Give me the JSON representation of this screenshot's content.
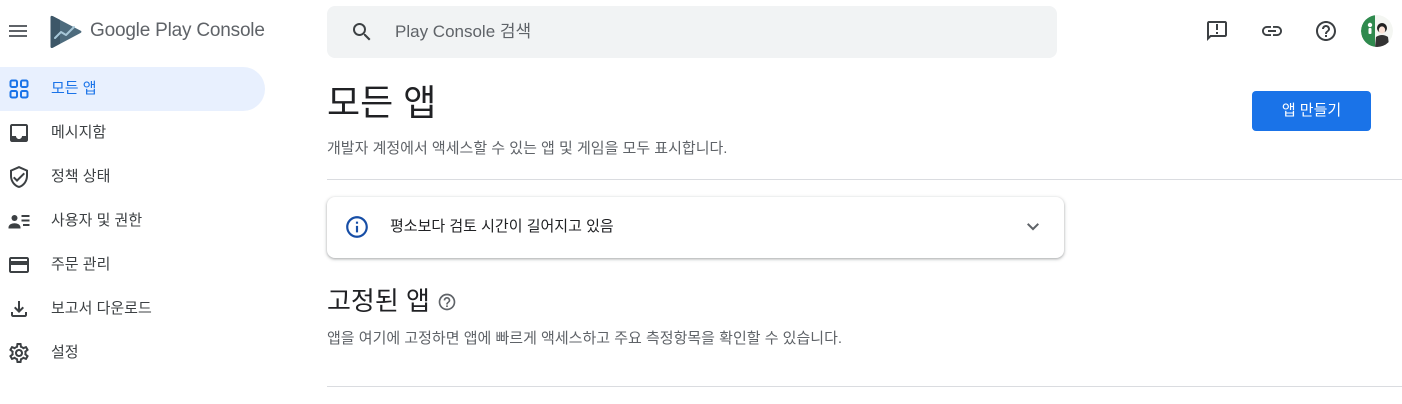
{
  "header": {
    "menu_icon": "menu-icon",
    "logo_icon": "play-console-logo-icon",
    "brand": "Google Play Console",
    "search": {
      "placeholder": "Play Console 검색",
      "value": "",
      "icon": "search-icon"
    },
    "actions": [
      {
        "icon": "feedback-icon"
      },
      {
        "icon": "link-icon"
      },
      {
        "icon": "help-icon"
      },
      {
        "icon": "avatar"
      }
    ]
  },
  "sidebar": {
    "items": [
      {
        "label": "모든 앱",
        "icon": "apps-grid-icon",
        "active": true
      },
      {
        "label": "메시지함",
        "icon": "inbox-icon",
        "active": false
      },
      {
        "label": "정책 상태",
        "icon": "shield-check-icon",
        "active": false
      },
      {
        "label": "사용자 및 권한",
        "icon": "users-permissions-icon",
        "active": false
      },
      {
        "label": "주문 관리",
        "icon": "credit-card-icon",
        "active": false
      },
      {
        "label": "보고서 다운로드",
        "icon": "download-icon",
        "active": false
      },
      {
        "label": "설정",
        "icon": "gear-icon",
        "active": false
      }
    ]
  },
  "main": {
    "title": "모든 앱",
    "subtitle": "개발자 계정에서 액세스할 수 있는 앱 및 게임을 모두 표시합니다.",
    "create_app_button": "앱 만들기",
    "notice": {
      "icon": "info-icon",
      "text": "평소보다 검토 시간이 길어지고 있음",
      "expand_icon": "chevron-down-icon"
    },
    "pinned_apps": {
      "title": "고정된 앱",
      "help_icon": "help-icon",
      "description": "앱을 여기에 고정하면 앱에 빠르게 액세스하고 주요 측정항목을 확인할 수 있습니다."
    }
  },
  "colors": {
    "accent": "#1a73e8",
    "active_nav_bg": "#e8f0fe",
    "search_bg": "#f1f3f4",
    "text_primary": "#202124",
    "text_secondary": "#5f6368",
    "info_icon": "#174ea6",
    "divider": "#dadce0"
  }
}
